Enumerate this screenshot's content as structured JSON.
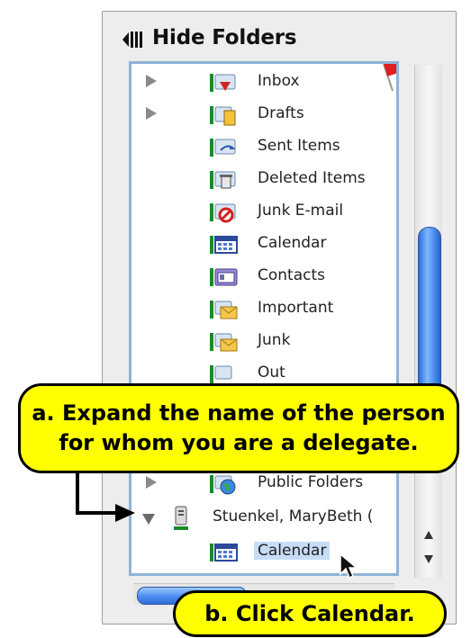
{
  "header": {
    "hide_folders_label": "Hide Folders"
  },
  "folders": [
    {
      "label": "Inbox",
      "icon": "inbox-icon",
      "expander": true
    },
    {
      "label": "Drafts",
      "icon": "drafts-icon",
      "expander": true
    },
    {
      "label": "Sent Items",
      "icon": "sent-items-icon",
      "expander": false
    },
    {
      "label": "Deleted Items",
      "icon": "deleted-items-icon",
      "expander": false
    },
    {
      "label": "Junk E-mail",
      "icon": "junk-email-icon",
      "expander": false
    },
    {
      "label": "Calendar",
      "icon": "calendar-icon",
      "expander": false
    },
    {
      "label": "Contacts",
      "icon": "contacts-icon",
      "expander": false
    },
    {
      "label": "Important",
      "icon": "important-folder-icon",
      "expander": false
    },
    {
      "label": "Junk",
      "icon": "junk-folder-icon",
      "expander": false
    },
    {
      "label": "Out",
      "icon": "out-folder-icon",
      "expander": false
    }
  ],
  "public_folders": {
    "label": "Public Folders",
    "icon": "public-folders-icon"
  },
  "delegate": {
    "label": "Stuenkel, MaryBeth (",
    "icon": "mailbox-user-icon"
  },
  "delegate_calendar": {
    "label": "Calendar",
    "icon": "calendar-icon"
  },
  "callouts": {
    "a_line1": "a.  Expand the name of the person",
    "a_line2": "for whom you are a delegate.",
    "b": "b.  Click Calendar."
  },
  "colors": {
    "callout": "#ffff00",
    "selection": "#c7dcf6",
    "pane_border": "#8fb3d9",
    "scroll_thumb": "#4a8cf0"
  }
}
